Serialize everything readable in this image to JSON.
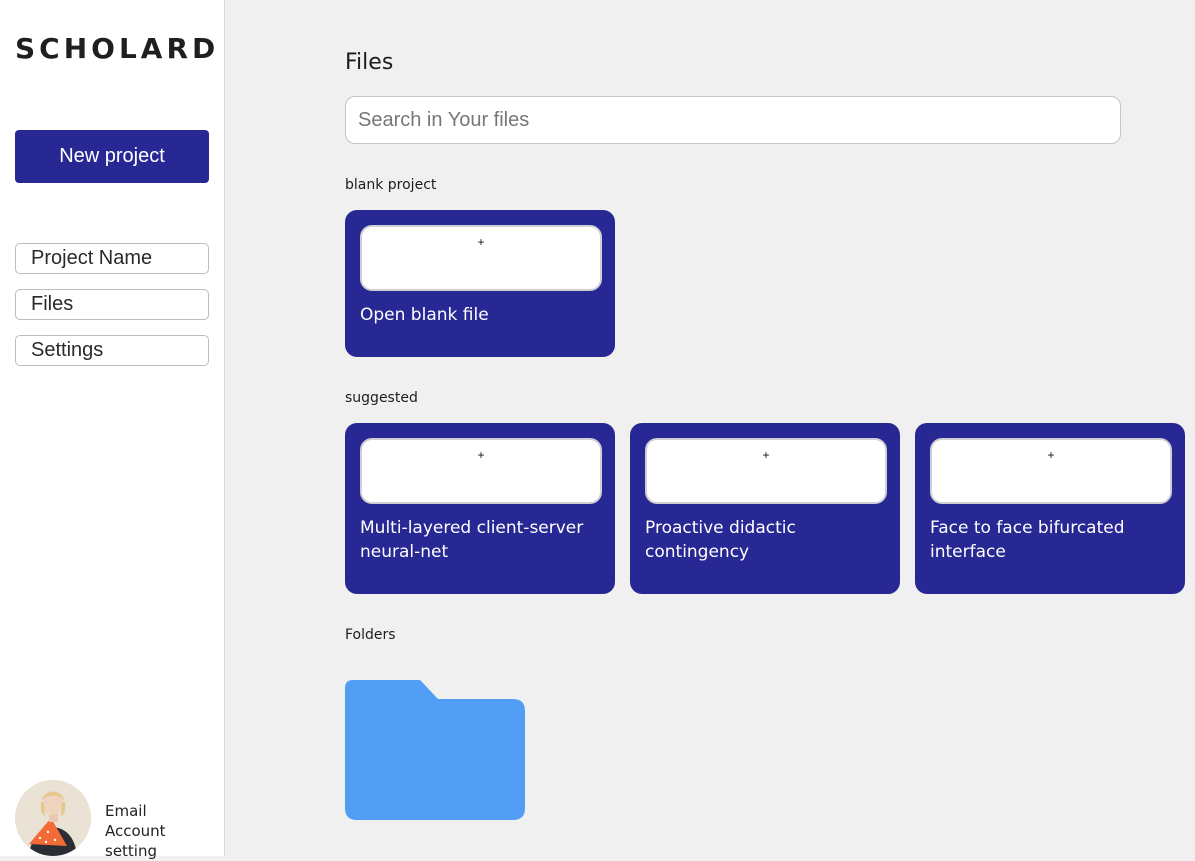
{
  "app": {
    "logo": "SCHOLARD"
  },
  "sidebar": {
    "new_project_label": "New project",
    "items": [
      {
        "label": "Project Name"
      },
      {
        "label": "Files"
      },
      {
        "label": "Settings"
      }
    ],
    "account": {
      "email_label": "Email",
      "settings_label": "Account setting"
    }
  },
  "main": {
    "title": "Files",
    "search": {
      "placeholder": "Search in Your files",
      "value": ""
    },
    "blank_section": {
      "label": "blank project",
      "card": {
        "thumb_symbol": "+",
        "label": "Open blank file"
      }
    },
    "suggested_section": {
      "label": "suggested",
      "cards": [
        {
          "thumb_symbol": "+",
          "label": "Multi-layered client-server neural-net"
        },
        {
          "thumb_symbol": "+",
          "label": "Proactive didactic contingency"
        },
        {
          "thumb_symbol": "+",
          "label": "Face to face bifurcated interface"
        }
      ]
    },
    "folders_section": {
      "label": "Folders",
      "folder_icon": "folder-icon"
    }
  },
  "colors": {
    "accent": "#272894",
    "folder": "#529ef5",
    "background": "#f0f0f0",
    "sidebar_bg": "#ffffff"
  }
}
